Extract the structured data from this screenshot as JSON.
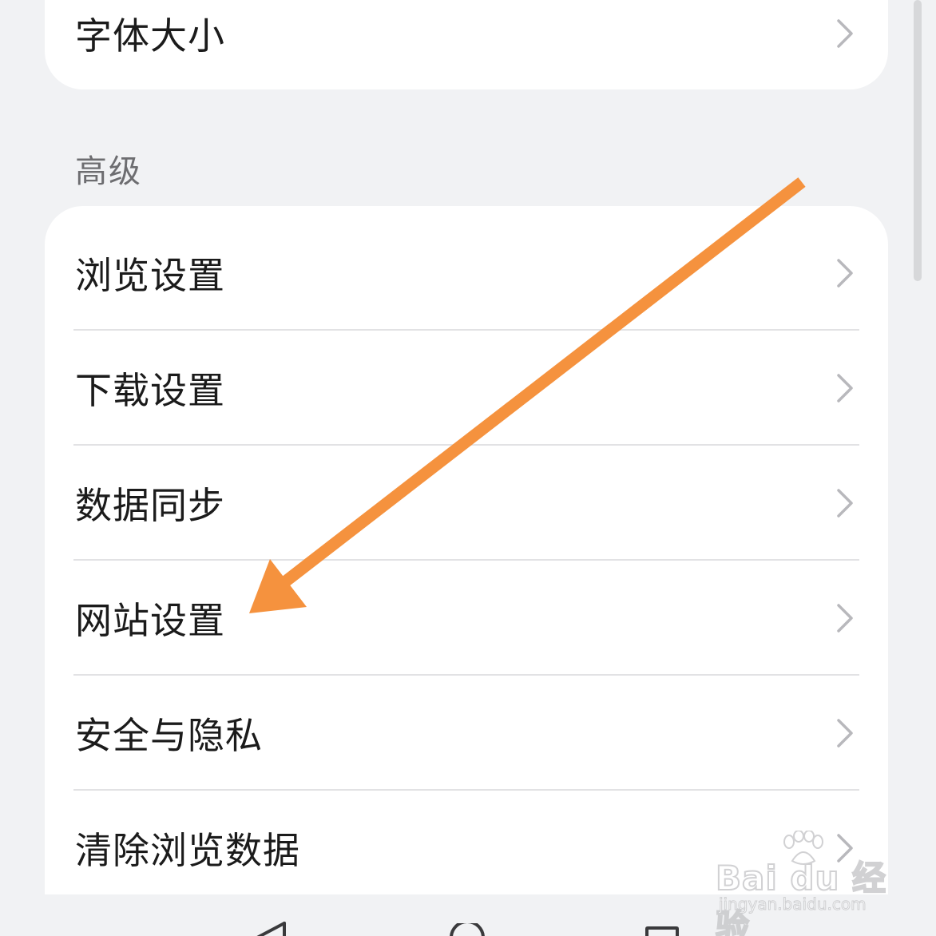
{
  "top_card": {
    "item": {
      "label": "字体大小"
    }
  },
  "advanced_section": {
    "header": "高级",
    "items": [
      {
        "label": "浏览设置"
      },
      {
        "label": "下载设置"
      },
      {
        "label": "数据同步"
      },
      {
        "label": "网站设置"
      },
      {
        "label": "安全与隐私"
      },
      {
        "label": "清除浏览数据"
      }
    ]
  },
  "annotation": {
    "arrow_color": "#f5923e",
    "points_to": "网站设置"
  },
  "navigation_bar": {
    "buttons": [
      "back-icon",
      "home-icon",
      "recents-icon"
    ]
  },
  "watermark": {
    "brand": "Bai du 经验",
    "url": "jingyan.baidu.com"
  },
  "colors": {
    "background": "#f1f2f4",
    "card": "#ffffff",
    "text": "#1b1b1b",
    "section_header": "#6d6d70",
    "divider": "#e2e2e4",
    "chevron": "#b8b8bc"
  }
}
